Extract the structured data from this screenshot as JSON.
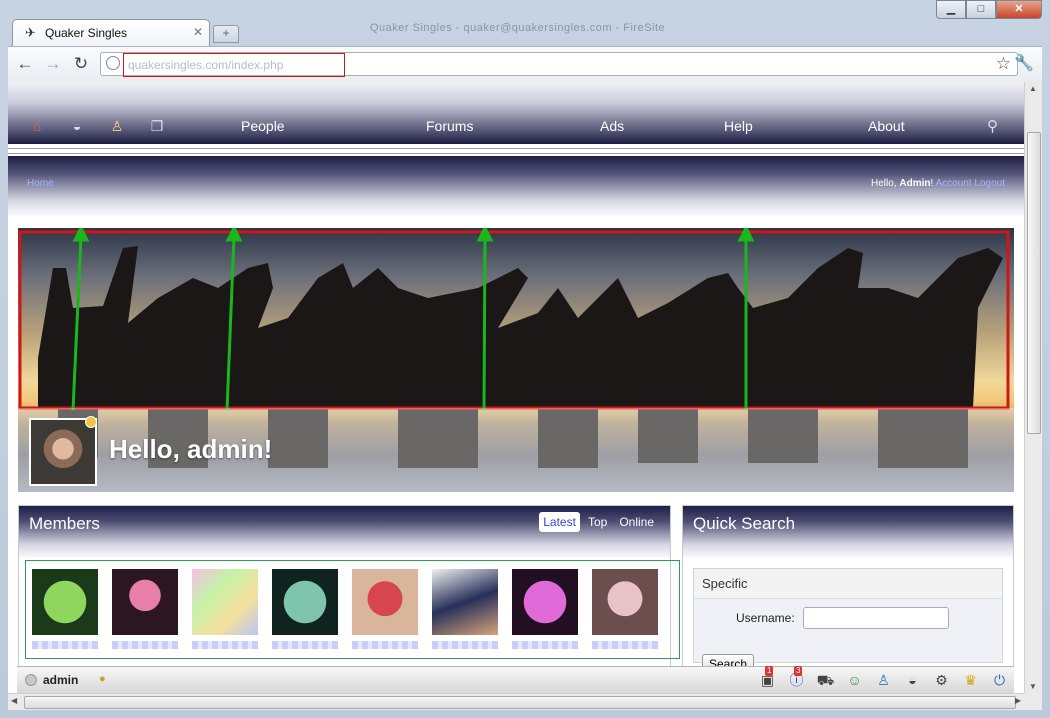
{
  "browser": {
    "tab_title": "Quaker Singles",
    "tab_favicon": "quaker-favicon",
    "window_title_ghost": "Quaker Singles - quaker@quakersingles.com - FireSite",
    "address_url": "quakersingles.com/index.php",
    "icons": [
      "back-icon",
      "forward-icon",
      "reload-icon",
      "star-icon",
      "wrench-icon",
      "minimize-icon",
      "maximize-icon",
      "close-icon"
    ]
  },
  "nav": {
    "icons": [
      "home-icon",
      "dashboard-icon",
      "profile-icon",
      "messages-icon",
      "search-icon"
    ],
    "links": [
      "People",
      "Forums",
      "Ads",
      "Help",
      "About"
    ]
  },
  "subnav": {
    "breadcrumb": "Home",
    "hello": "Hello,",
    "user": "Admin",
    "exclaim": "!",
    "account": "Account",
    "logout": "Logout"
  },
  "banner": {
    "greeting": "Hello, admin!"
  },
  "members": {
    "title": "Members",
    "tabs": [
      "Latest",
      "Top",
      "Online"
    ],
    "active_tab": "Latest",
    "count_shown": 8
  },
  "quick_search": {
    "title": "Quick Search",
    "section": "Specific",
    "username_label": "Username:",
    "username_value": "",
    "button": "Search"
  },
  "bottombar": {
    "user": "admin",
    "badges": [
      "1",
      "3"
    ],
    "icons": [
      "notifications-icon",
      "info-icon",
      "cart-icon",
      "friends-icon",
      "profile-icon",
      "dashboard-icon",
      "settings-icon",
      "crown-icon",
      "power-icon"
    ]
  },
  "colors": {
    "nav_dark": "#1d1d44",
    "link": "#a5b3ff",
    "highlight_red": "#d21515",
    "arrow_green": "#19b81a",
    "grid_green": "#2e9f4e"
  }
}
